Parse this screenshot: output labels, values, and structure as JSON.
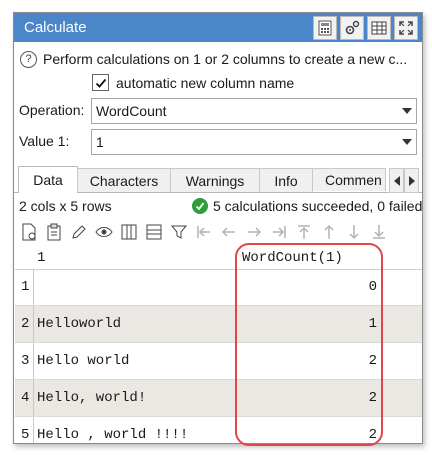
{
  "window": {
    "title": "Calculate"
  },
  "titlebar_icons": [
    "calculator-icon",
    "settings-icon",
    "table-icon",
    "expand-icon"
  ],
  "description": "Perform calculations on 1 or 2 columns to create a new c...",
  "auto_name": {
    "label": "automatic new column name",
    "checked": true
  },
  "operation": {
    "label": "Operation:",
    "value": "WordCount"
  },
  "value1": {
    "label": "Value 1:",
    "value": "1"
  },
  "tabs": [
    {
      "label": "Data",
      "active": true
    },
    {
      "label": "Characters"
    },
    {
      "label": "Warnings"
    },
    {
      "label": "Info"
    },
    {
      "label": "Commen"
    }
  ],
  "status": {
    "dims": "2 cols x 5 rows",
    "message": "5 calculations succeeded, 0 failed"
  },
  "grid": {
    "columns": [
      "1",
      "WordCount(1)"
    ],
    "rows": [
      {
        "index": "1",
        "text": "",
        "count": "0"
      },
      {
        "index": "2",
        "text": "Helloworld",
        "count": "1"
      },
      {
        "index": "3",
        "text": "Hello world",
        "count": "2"
      },
      {
        "index": "4",
        "text": "Hello, world!",
        "count": "2"
      },
      {
        "index": "5",
        "text": "Hello , world !!!!",
        "count": "2"
      }
    ]
  },
  "colors": {
    "titlebar": "#4a86c8",
    "alt_row": "#ebe8e3",
    "highlight": "#e0474c",
    "success": "#2e9e3a"
  }
}
